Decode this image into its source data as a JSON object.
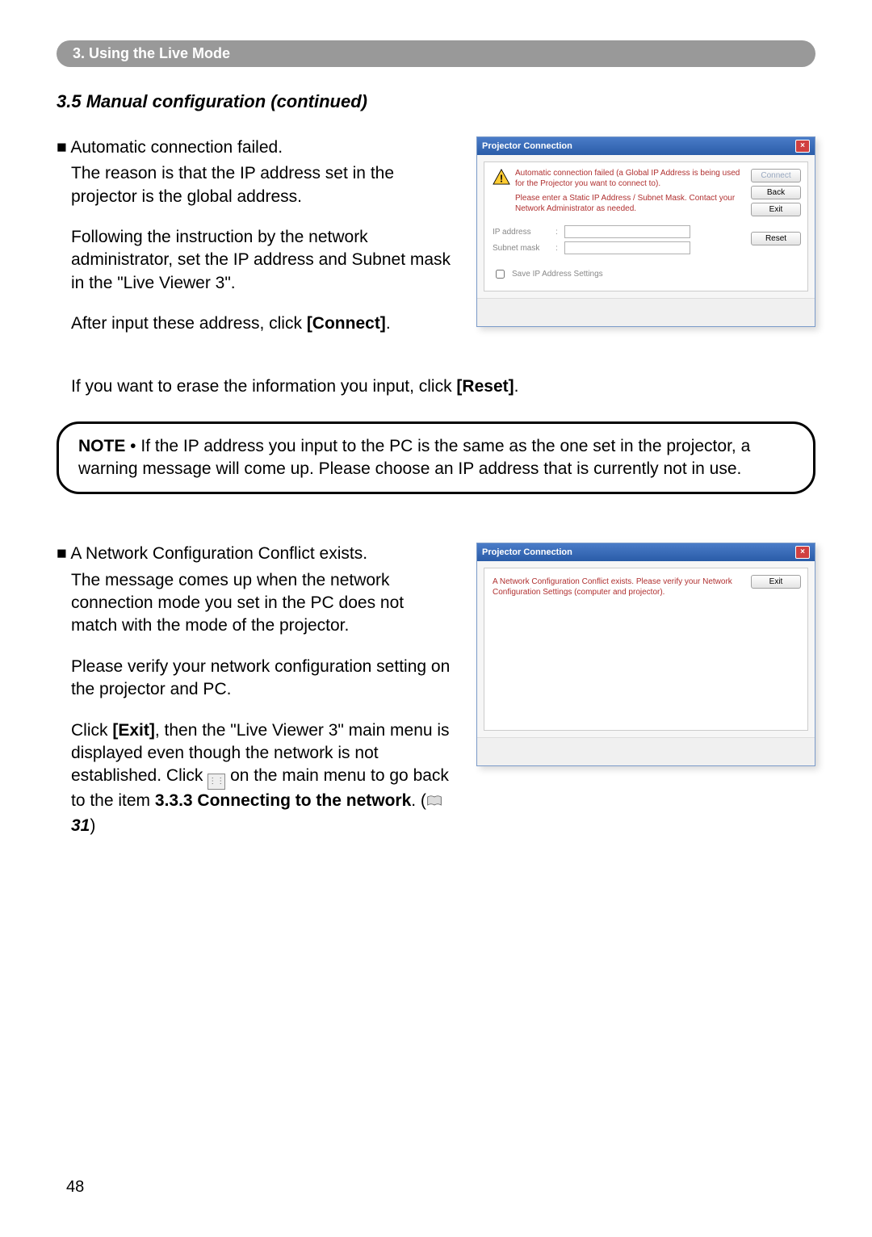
{
  "sectionHeader": "3. Using the Live Mode",
  "subsection": "3.5 Manual configuration (continued)",
  "block1": {
    "heading": "Automatic connection failed.",
    "p1": "The reason is that the IP address set in the projector is the global address.",
    "p2": "Following the instruction by the network administrator, set the IP address and Subnet mask in the \"Live Viewer 3\".",
    "p3_pre": "After input these address, click ",
    "p3_bold": "[Connect]",
    "p3_post": "."
  },
  "full1_pre": "If you want to erase the information you input, click ",
  "full1_bold": "[Reset]",
  "full1_post": ".",
  "note": {
    "label": "NOTE",
    "text": " • If the IP address you input to the PC is the same as the one set in the projector, a warning message will come up. Please choose an IP address that is currently not in use."
  },
  "block2": {
    "heading": "A Network Configuration Conflict exists.",
    "p1": "The message comes up when the network connection mode you set in the PC does not match with the mode of the projector.",
    "p2": "Please verify your network configuration setting on the projector and PC.",
    "p3_a": "Click ",
    "p3_bold1": "[Exit]",
    "p3_b": ", then the \"Live Viewer 3\" main menu is displayed even though the network is not established. Click ",
    "p3_c": " on the main menu to go back to the item ",
    "p3_bold2": "3.3.3 Connecting to the network",
    "p3_d": ". (",
    "p3_ref": "31",
    "p3_e": ")"
  },
  "dialog1": {
    "title": "Projector Connection",
    "warn1": "Automatic connection failed (a Global IP Address is being used for the Projector you want to connect to).",
    "warn2": "Please enter a Static IP Address / Subnet Mask. Contact your Network Administrator as needed.",
    "connect": "Connect",
    "back": "Back",
    "exit": "Exit",
    "ip_label": "IP address",
    "subnet_label": "Subnet mask",
    "reset": "Reset",
    "save": "Save IP Address Settings"
  },
  "dialog2": {
    "title": "Projector Connection",
    "text": "A Network Configuration Conflict exists. Please verify your Network Configuration Settings (computer and projector).",
    "exit": "Exit"
  },
  "pageNumber": "48"
}
